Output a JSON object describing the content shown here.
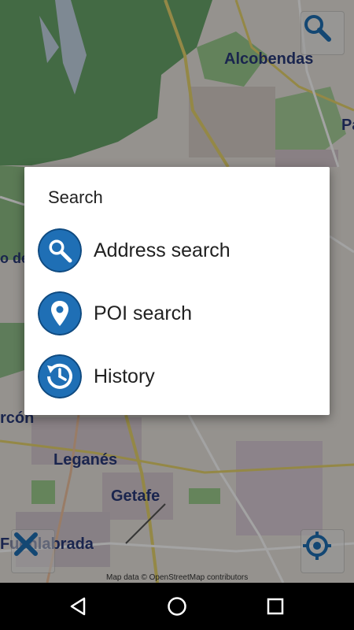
{
  "map": {
    "cities": [
      "Alcobendas",
      "Pa",
      "o de",
      "rcón",
      "Leganés",
      "Getafe",
      "Fuenlabrada"
    ],
    "attribution": "Map data © OpenStreetMap contributors",
    "buttons": [
      {
        "name": "map-search-button",
        "icon": "search-icon"
      },
      {
        "name": "map-close-button",
        "icon": "close-icon"
      },
      {
        "name": "map-location-button",
        "icon": "crosshair-location-icon"
      }
    ]
  },
  "dialog": {
    "title": "Search",
    "options": [
      {
        "label": "Address search",
        "icon": "magnifier-icon"
      },
      {
        "label": "POI search",
        "icon": "location-pin-icon"
      },
      {
        "label": "History",
        "icon": "history-clock-icon"
      }
    ]
  },
  "navbar": {
    "buttons": [
      {
        "name": "back",
        "icon": "back-triangle-icon"
      },
      {
        "name": "home",
        "icon": "home-circle-icon"
      },
      {
        "name": "recents",
        "icon": "recents-square-icon"
      }
    ]
  },
  "colors": {
    "icon_blue": "#1f6fb5",
    "map_green": "#6ca56a",
    "map_label": "#2a3b7a"
  }
}
